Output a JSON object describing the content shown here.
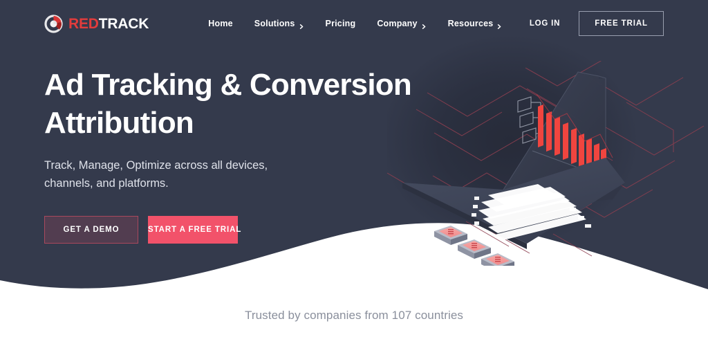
{
  "theme": {
    "bg_dark": "#343a4c",
    "bg_illustration": "#272b39",
    "accent_red": "#f2526a",
    "logo_red": "#e23c3c",
    "text_white": "#ffffff",
    "text_muted": "#8a8f9c"
  },
  "header": {
    "logo": {
      "icon": "redtrack-circle-logo",
      "text_red": "RED",
      "text_white": "TRACK"
    },
    "nav": [
      {
        "label": "Home",
        "has_chevron": false
      },
      {
        "label": "Solutions",
        "has_chevron": true
      },
      {
        "label": "Pricing",
        "has_chevron": false
      },
      {
        "label": "Company",
        "has_chevron": true
      },
      {
        "label": "Resources",
        "has_chevron": true
      }
    ],
    "login_label": "LOG IN",
    "trial_label": "FREE TRIAL"
  },
  "hero": {
    "headline_line1": "Ad Tracking & Conversion",
    "headline_line2": "Attribution",
    "subhead_line1": "Track, Manage, Optimize across all devices,",
    "subhead_line2": "channels, and platforms.",
    "cta_demo": "GET A DEMO",
    "cta_trial": "START A FREE TRIAL"
  },
  "illustration": {
    "name": "isometric-laptop-analytics",
    "screen_chart": {
      "type": "bar",
      "values": [
        100,
        86,
        72,
        63,
        54,
        44,
        35,
        26,
        17
      ],
      "color": "#f0453f"
    },
    "chips": [
      "chip-1",
      "chip-2",
      "chip-3"
    ],
    "circuit_line_color": "#8d3f50"
  },
  "footer": {
    "trusted_text": "Trusted by companies from 107 countries"
  }
}
